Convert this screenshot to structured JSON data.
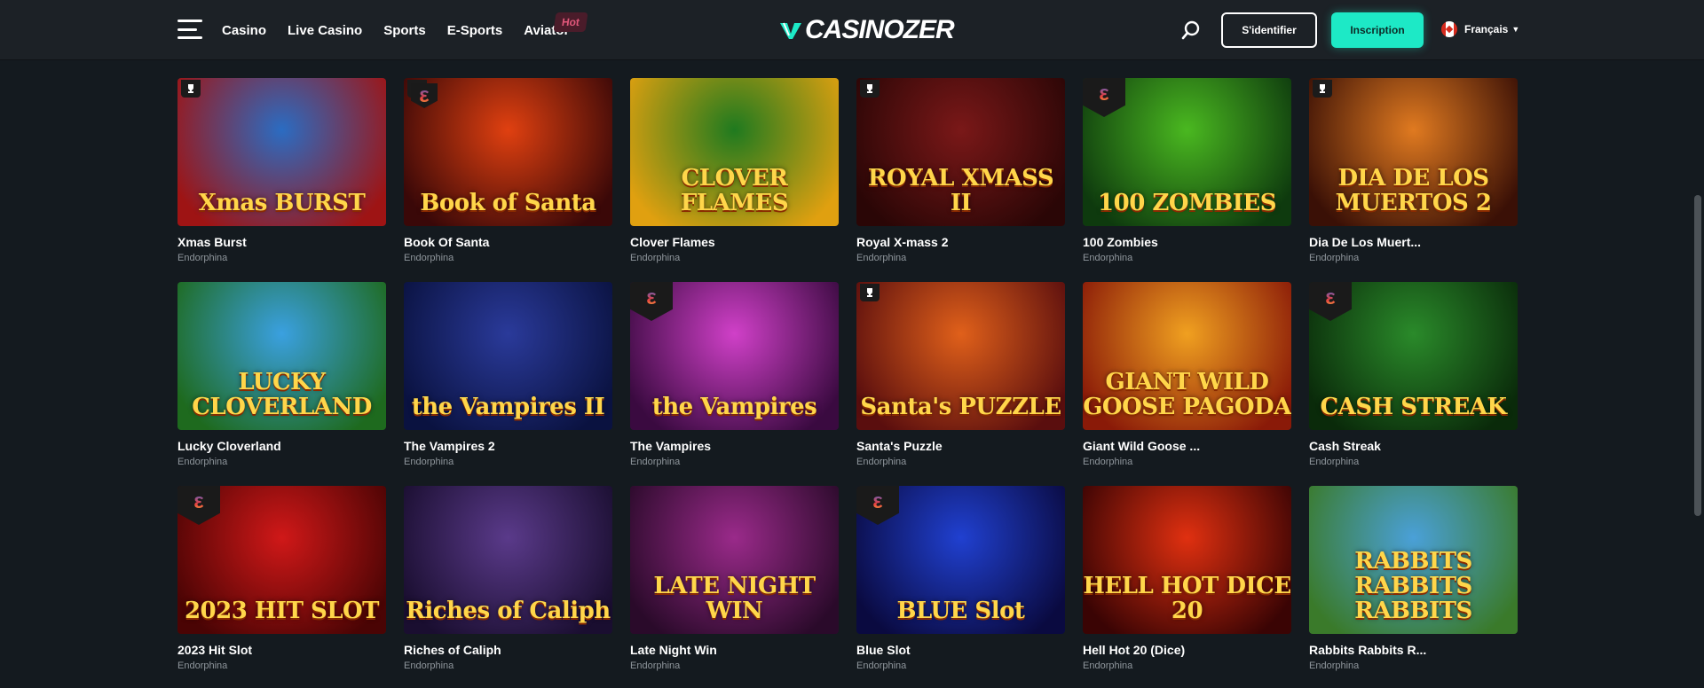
{
  "header": {
    "nav": [
      {
        "label": "Casino"
      },
      {
        "label": "Live Casino"
      },
      {
        "label": "Sports"
      },
      {
        "label": "E-Sports"
      },
      {
        "label": "Aviator"
      }
    ],
    "hot_badge": "Hot",
    "logo_text": "CASINOZER",
    "login_label": "S'identifier",
    "signup_label": "Inscription",
    "language": "Français"
  },
  "games": [
    {
      "name": "Xmas Burst",
      "provider": "Endorphina",
      "art_title": "Xmas BURST",
      "badge": "trophy",
      "bg": [
        "#2b6cc2",
        "#9e1414"
      ]
    },
    {
      "name": "Book Of Santa",
      "provider": "Endorphina",
      "art_title": "Book of Santa",
      "badge": "trophy-e",
      "bg": [
        "#e04010",
        "#3a0808"
      ]
    },
    {
      "name": "Clover Flames",
      "provider": "Endorphina",
      "art_title": "CLOVER FLAMES",
      "badge": "",
      "bg": [
        "#1f7a1f",
        "#e0a010"
      ]
    },
    {
      "name": "Royal X-mass 2",
      "provider": "Endorphina",
      "art_title": "ROYAL XMASS II",
      "badge": "trophy",
      "bg": [
        "#7a1818",
        "#2a0606"
      ]
    },
    {
      "name": "100 Zombies",
      "provider": "Endorphina",
      "art_title": "100 ZOMBIES",
      "badge": "e",
      "bg": [
        "#4ab820",
        "#0e3a0e"
      ]
    },
    {
      "name": "Dia De Los Muert...",
      "provider": "Endorphina",
      "art_title": "DIA DE LOS MUERTOS 2",
      "badge": "trophy",
      "bg": [
        "#e07a20",
        "#3a1006"
      ]
    },
    {
      "name": "Lucky Cloverland",
      "provider": "Endorphina",
      "art_title": "LUCKY CLOVERLAND",
      "badge": "",
      "bg": [
        "#3aa0e0",
        "#1e6a1e"
      ]
    },
    {
      "name": "The Vampires 2",
      "provider": "Endorphina",
      "art_title": "the Vampires II",
      "badge": "",
      "bg": [
        "#2a3a9a",
        "#0a1240"
      ]
    },
    {
      "name": "The Vampires",
      "provider": "Endorphina",
      "art_title": "the Vampires",
      "badge": "e",
      "bg": [
        "#d040c8",
        "#3a0a40"
      ]
    },
    {
      "name": "Santa's Puzzle",
      "provider": "Endorphina",
      "art_title": "Santa's PUZZLE",
      "badge": "trophy",
      "bg": [
        "#e0601a",
        "#5a0e0e"
      ]
    },
    {
      "name": "Giant Wild Goose ...",
      "provider": "Endorphina",
      "art_title": "GIANT WILD GOOSE PAGODA",
      "badge": "",
      "bg": [
        "#f0a020",
        "#8a1a08"
      ]
    },
    {
      "name": "Cash Streak",
      "provider": "Endorphina",
      "art_title": "CASH STREAK",
      "badge": "e",
      "bg": [
        "#2a8a2a",
        "#0a2a0a"
      ]
    },
    {
      "name": "2023 Hit Slot",
      "provider": "Endorphina",
      "art_title": "2023 HIT SLOT",
      "badge": "e",
      "bg": [
        "#d01818",
        "#4a0404"
      ]
    },
    {
      "name": "Riches of Caliph",
      "provider": "Endorphina",
      "art_title": "Riches of Caliph",
      "badge": "",
      "bg": [
        "#5a3a8a",
        "#1a0e30"
      ]
    },
    {
      "name": "Late Night Win",
      "provider": "Endorphina",
      "art_title": "LATE NIGHT WIN",
      "badge": "",
      "bg": [
        "#9a2a8a",
        "#2a0a2a"
      ]
    },
    {
      "name": "Blue Slot",
      "provider": "Endorphina",
      "art_title": "BLUE Slot",
      "badge": "e",
      "bg": [
        "#2040d0",
        "#0a0a40"
      ]
    },
    {
      "name": "Hell Hot 20 (Dice)",
      "provider": "Endorphina",
      "art_title": "HELL HOT DICE 20",
      "badge": "",
      "bg": [
        "#e03010",
        "#3a0404"
      ]
    },
    {
      "name": "Rabbits Rabbits R...",
      "provider": "Endorphina",
      "art_title": "RABBITS RABBITS RABBITS",
      "badge": "",
      "bg": [
        "#4aa0d8",
        "#3a7a2a"
      ]
    }
  ]
}
